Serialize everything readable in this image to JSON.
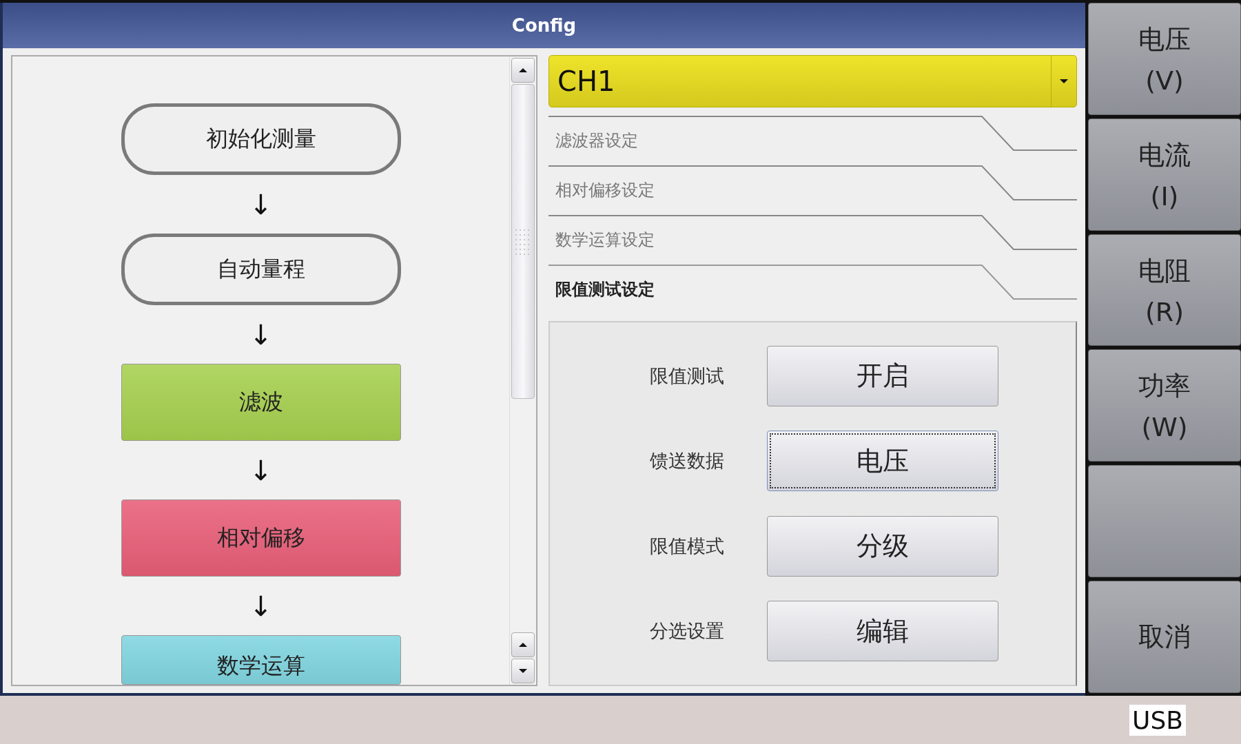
{
  "window": {
    "title": "Config"
  },
  "flow": [
    {
      "kind": "outline",
      "label": "初始化测量"
    },
    {
      "kind": "arrow",
      "label": "↓"
    },
    {
      "kind": "outline",
      "label": "自动量程"
    },
    {
      "kind": "arrow",
      "label": "↓"
    },
    {
      "kind": "filled",
      "label": "滤波",
      "color": "#a6d04e"
    },
    {
      "kind": "arrow",
      "label": "↓"
    },
    {
      "kind": "filled",
      "label": "相对偏移",
      "color": "#e85e78"
    },
    {
      "kind": "arrow",
      "label": "↓"
    },
    {
      "kind": "filled",
      "label": "数学运算",
      "color": "#80d5e0"
    }
  ],
  "channel_select": {
    "value": "CH1"
  },
  "tabs": [
    {
      "label": "滤波器设定",
      "selected": false
    },
    {
      "label": "相对偏移设定",
      "selected": false
    },
    {
      "label": "数学运算设定",
      "selected": false
    },
    {
      "label": "限值测试设定",
      "selected": true
    }
  ],
  "settings": [
    {
      "label": "限值测试",
      "value": "开启",
      "focused": false
    },
    {
      "label": "馈送数据",
      "value": "电压",
      "focused": true
    },
    {
      "label": "限值模式",
      "value": "分级",
      "focused": false
    },
    {
      "label": "分选设置",
      "value": "编辑",
      "focused": false
    }
  ],
  "softkeys": [
    {
      "kind": "two_line",
      "label": "电压",
      "sub": "(V)"
    },
    {
      "kind": "two_line",
      "label": "电流",
      "sub": "(I)"
    },
    {
      "kind": "two_line",
      "label": "电阻",
      "sub": "(R)"
    },
    {
      "kind": "two_line",
      "label": "功率",
      "sub": "(W)"
    },
    {
      "kind": "blank"
    },
    {
      "kind": "one_line",
      "label": "取消"
    }
  ],
  "status_bar": {
    "usb": "USB"
  }
}
